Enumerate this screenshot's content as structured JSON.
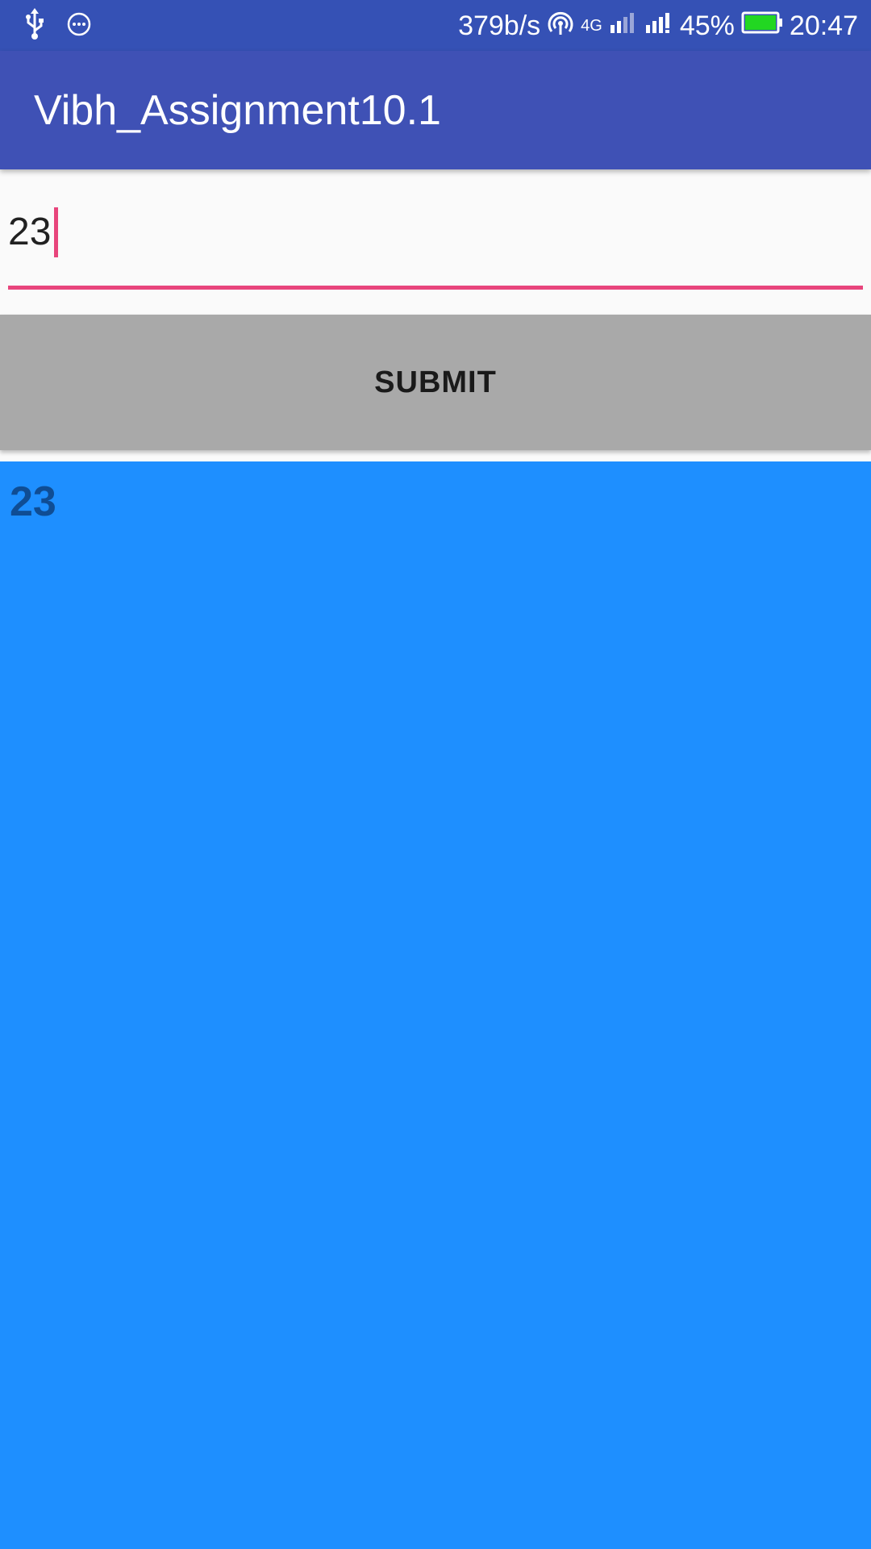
{
  "status_bar": {
    "network_speed": "379b/s",
    "network_type": "4G",
    "battery_percent": "45%",
    "battery_level": 0.45,
    "time": "20:47",
    "icons": [
      "usb-icon",
      "more-circle-icon",
      "hotspot-icon",
      "signal-1-icon",
      "signal-2-icon",
      "battery-icon"
    ]
  },
  "app_bar": {
    "title": "Vibh_Assignment10.1"
  },
  "input": {
    "value": "23"
  },
  "submit": {
    "label": "SUBMIT"
  },
  "result": {
    "text": "23"
  },
  "colors": {
    "status_bar": "#3551b5",
    "app_bar": "#3f51b5",
    "accent": "#e8457c",
    "button": "#a9a9a9",
    "result_background": "#1e8fff",
    "result_text": "#0f4d94",
    "battery_fill": "#22d722"
  }
}
